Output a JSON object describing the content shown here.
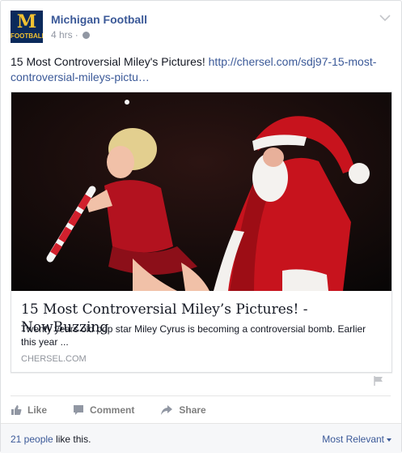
{
  "post": {
    "author": "Michigan Football",
    "avatar_mark": "M",
    "avatar_text": "FOOTBALL",
    "time": "4 hrs",
    "privacy_icon": "globe-icon",
    "text": "15 Most Controversial Miley's Pictures!",
    "link_url": "http://chersel.com/sdj97-15-most-controversial-mileys-pictu…"
  },
  "link_card": {
    "title": "15 Most Controversial Miley’s Pictures! - NowBuzzing",
    "description": "Twenty years old pop star Miley Cyrus is becoming a controversial bomb. Earlier this year ...",
    "domain": "CHERSEL.COM"
  },
  "actions": {
    "like": "Like",
    "comment": "Comment",
    "share": "Share"
  },
  "likes": {
    "people": "21 people",
    "suffix": " like this.",
    "sort": "Most Relevant"
  },
  "colors": {
    "link": "#3b5998",
    "brand_navy": "#0b2a5b",
    "brand_maize": "#f2c232"
  }
}
